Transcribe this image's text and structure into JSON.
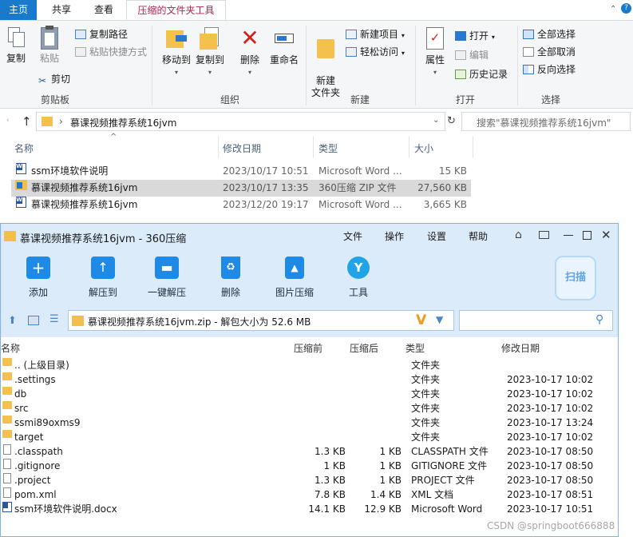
{
  "explorer": {
    "tabs": [
      "主页",
      "共享",
      "查看",
      "压缩的文件夹工具"
    ],
    "ribbon": {
      "clipboard": {
        "copy": "复制",
        "paste": "粘贴",
        "copy_path": "复制路径",
        "paste_shortcut": "粘贴快捷方式",
        "cut": "剪切",
        "label": "剪贴板"
      },
      "organize": {
        "move_to": "移动到",
        "copy_to": "复制到",
        "delete": "删除",
        "rename": "重命名",
        "label": "组织"
      },
      "new": {
        "new_folder": "新建\n文件夹",
        "new_item": "新建项目",
        "easy_access": "轻松访问",
        "label": "新建"
      },
      "open": {
        "properties": "属性",
        "open": "打开",
        "edit": "编辑",
        "history": "历史记录",
        "label": "打开"
      },
      "select": {
        "select_all": "全部选择",
        "select_none": "全部取消",
        "invert": "反向选择",
        "label": "选择"
      }
    },
    "address": {
      "path": "慕课视频推荐系统16jvm",
      "search_placeholder": "搜索\"慕课视频推荐系统16jvm\""
    },
    "columns": [
      "名称",
      "修改日期",
      "类型",
      "大小"
    ],
    "files": [
      {
        "name": "ssm环境软件说明",
        "date": "2023/10/17 10:51",
        "type": "Microsoft Word ...",
        "size": "15 KB",
        "icon": "word-icon"
      },
      {
        "name": "慕课视频推荐系统16jvm",
        "date": "2023/10/17 13:35",
        "type": "360压缩 ZIP 文件",
        "size": "27,560 KB",
        "icon": "zip-icon"
      },
      {
        "name": "慕课视频推荐系统16jvm",
        "date": "2023/12/20 19:17",
        "type": "Microsoft Word ...",
        "size": "3,665 KB",
        "icon": "word-icon"
      }
    ]
  },
  "zip": {
    "title": "慕课视频推荐系统16jvm - 360压缩",
    "menu": [
      "文件",
      "操作",
      "设置",
      "帮助"
    ],
    "toolbar": [
      "添加",
      "解压到",
      "一键解压",
      "删除",
      "图片压缩",
      "工具"
    ],
    "scan": "扫描",
    "path": "慕课视频推荐系统16jvm.zip - 解包大小为 52.6 MB",
    "columns": [
      "名称",
      "压缩前",
      "压缩后",
      "类型",
      "修改日期"
    ],
    "rows": [
      {
        "name": ".. (上级目录)",
        "before": "",
        "after": "",
        "type": "文件夹",
        "date": "",
        "icon": "folder"
      },
      {
        "name": ".settings",
        "before": "",
        "after": "",
        "type": "文件夹",
        "date": "2023-10-17 10:02",
        "icon": "folder"
      },
      {
        "name": "db",
        "before": "",
        "after": "",
        "type": "文件夹",
        "date": "2023-10-17 10:02",
        "icon": "folder"
      },
      {
        "name": "src",
        "before": "",
        "after": "",
        "type": "文件夹",
        "date": "2023-10-17 10:02",
        "icon": "folder"
      },
      {
        "name": "ssmi89oxms9",
        "before": "",
        "after": "",
        "type": "文件夹",
        "date": "2023-10-17 13:24",
        "icon": "folder"
      },
      {
        "name": "target",
        "before": "",
        "after": "",
        "type": "文件夹",
        "date": "2023-10-17 10:02",
        "icon": "folder"
      },
      {
        "name": ".classpath",
        "before": "1.3 KB",
        "after": "1 KB",
        "type": "CLASSPATH 文件",
        "date": "2023-10-17 08:50",
        "icon": "file"
      },
      {
        "name": ".gitignore",
        "before": "1 KB",
        "after": "1 KB",
        "type": "GITIGNORE 文件",
        "date": "2023-10-17 08:50",
        "icon": "file"
      },
      {
        "name": ".project",
        "before": "1.3 KB",
        "after": "1 KB",
        "type": "PROJECT 文件",
        "date": "2023-10-17 08:50",
        "icon": "file"
      },
      {
        "name": "pom.xml",
        "before": "7.8 KB",
        "after": "1.4 KB",
        "type": "XML 文档",
        "date": "2023-10-17 08:51",
        "icon": "file"
      },
      {
        "name": "ssm环境软件说明.docx",
        "before": "14.1 KB",
        "after": "12.9 KB",
        "type": "Microsoft Word",
        "date": "2023-10-17 10:51",
        "icon": "word"
      }
    ]
  },
  "watermark": "CSDN @springboot666888"
}
